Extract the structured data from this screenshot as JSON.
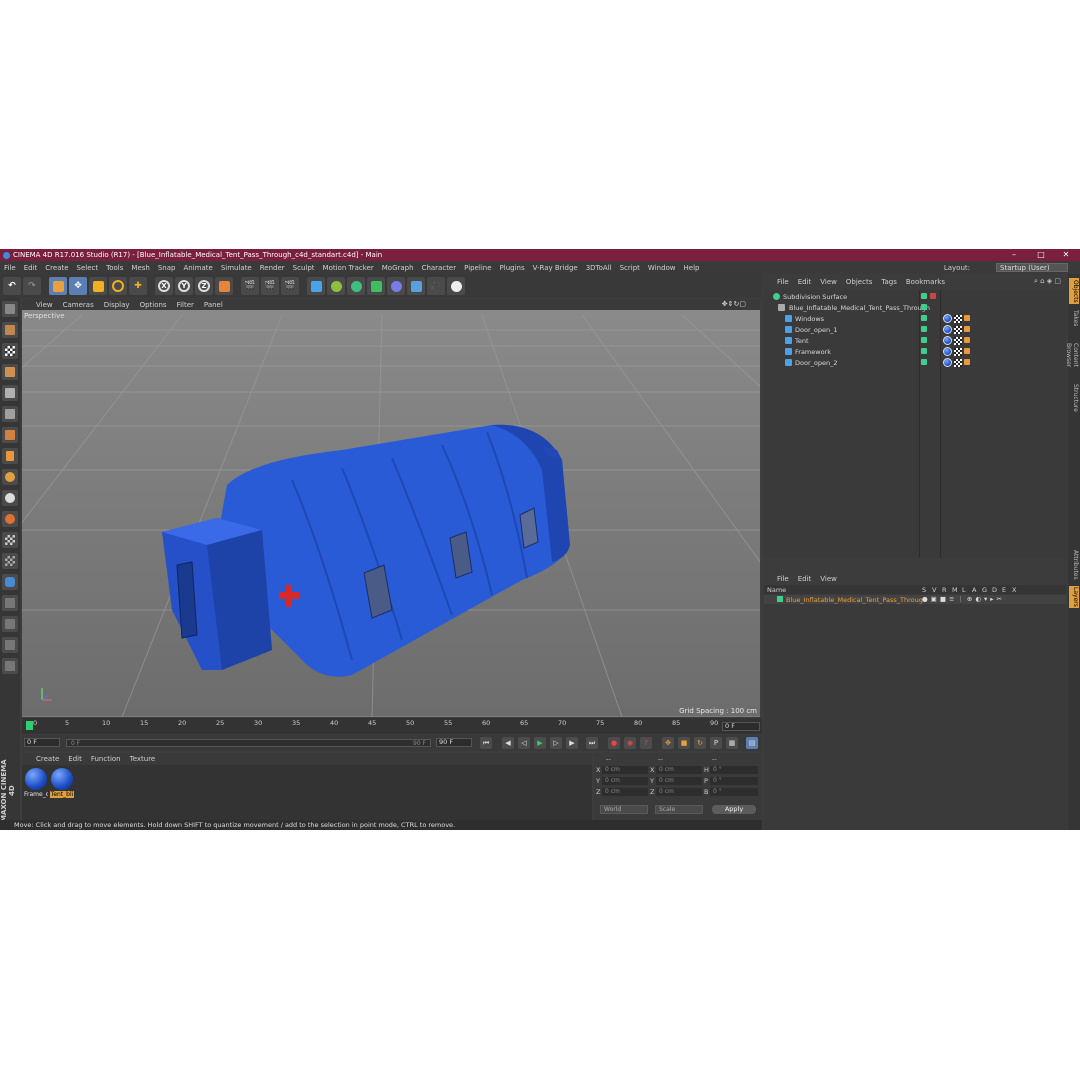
{
  "window": {
    "title": "CINEMA 4D R17.016 Studio (R17) - [Blue_Inflatable_Medical_Tent_Pass_Through_c4d_standart.c4d] - Main",
    "minimize": "–",
    "maximize": "□",
    "close": "✕"
  },
  "menu": [
    "File",
    "Edit",
    "Create",
    "Select",
    "Tools",
    "Mesh",
    "Snap",
    "Animate",
    "Simulate",
    "Render",
    "Sculpt",
    "Motion Tracker",
    "MoGraph",
    "Character",
    "Pipeline",
    "Plugins",
    "V-Ray Bridge",
    "3DToAll",
    "Script",
    "Window",
    "Help"
  ],
  "layout": {
    "label": "Layout:",
    "value": "Startup (User)"
  },
  "toolbar": {
    "x_label": "X",
    "y_label": "Y",
    "z_label": "Z"
  },
  "viewport": {
    "menu": [
      "View",
      "Cameras",
      "Display",
      "Options",
      "Filter",
      "Panel"
    ],
    "label": "Perspective",
    "grid_spacing": "Grid Spacing : 100 cm"
  },
  "timeline": {
    "ticks": [
      "0",
      "5",
      "10",
      "15",
      "20",
      "25",
      "30",
      "35",
      "40",
      "45",
      "50",
      "55",
      "60",
      "65",
      "70",
      "75",
      "80",
      "85",
      "90"
    ],
    "end_frame": "0 F"
  },
  "playback": {
    "start": "0 F",
    "current": "0 F",
    "range_end": "90 F",
    "end": "90 F"
  },
  "materials": {
    "menu": [
      "Create",
      "Edit",
      "Function",
      "Texture"
    ],
    "items": [
      {
        "label": "Frame_o",
        "selected": false
      },
      {
        "label": "Tent_bli",
        "selected": true
      }
    ]
  },
  "coordinates": {
    "header_left": "--",
    "header_mid": "--",
    "header_right": "--",
    "rows": [
      {
        "a_label": "X",
        "a_val": "0 cm",
        "b_label": "X",
        "b_val": "0 cm",
        "c_label": "H",
        "c_val": "0 °"
      },
      {
        "a_label": "Y",
        "a_val": "0 cm",
        "b_label": "Y",
        "b_val": "0 cm",
        "c_label": "P",
        "c_val": "0 °"
      },
      {
        "a_label": "Z",
        "a_val": "0 cm",
        "b_label": "Z",
        "b_val": "0 cm",
        "c_label": "B",
        "c_val": "0 °"
      }
    ],
    "space": "World",
    "mode": "Scale",
    "apply": "Apply"
  },
  "status": "Move: Click and drag to move elements. Hold down SHIFT to quantize movement / add to the selection in point mode, CTRL to remove.",
  "maxon": "MAXON CINEMA 4D",
  "objects": {
    "menu": [
      "File",
      "Edit",
      "View",
      "Objects",
      "Tags",
      "Bookmarks"
    ],
    "rows": [
      {
        "name": "Subdivision Surface",
        "indent": 0
      },
      {
        "name": "Blue_Inflatable_Medical_Tent_Pass_Through",
        "indent": 1
      },
      {
        "name": "Windows",
        "indent": 2
      },
      {
        "name": "Door_open_1",
        "indent": 2
      },
      {
        "name": "Tent",
        "indent": 2
      },
      {
        "name": "Framework",
        "indent": 2
      },
      {
        "name": "Door_open_2",
        "indent": 2
      }
    ]
  },
  "layers": {
    "menu": [
      "File",
      "Edit",
      "View"
    ],
    "columns": [
      "Name",
      "S",
      "V",
      "R",
      "M",
      "L",
      "A",
      "G",
      "D",
      "E",
      "X"
    ],
    "row": "Blue_Inflatable_Medical_Tent_Pass_Through"
  },
  "side_tabs": [
    "Objects",
    "Takes",
    "Content Browser",
    "Structure",
    "Attributes",
    "Layers"
  ],
  "colors": {
    "accent": "#e0a040",
    "titlebar": "#7a1f3d",
    "tent": "#2a5bd7"
  }
}
